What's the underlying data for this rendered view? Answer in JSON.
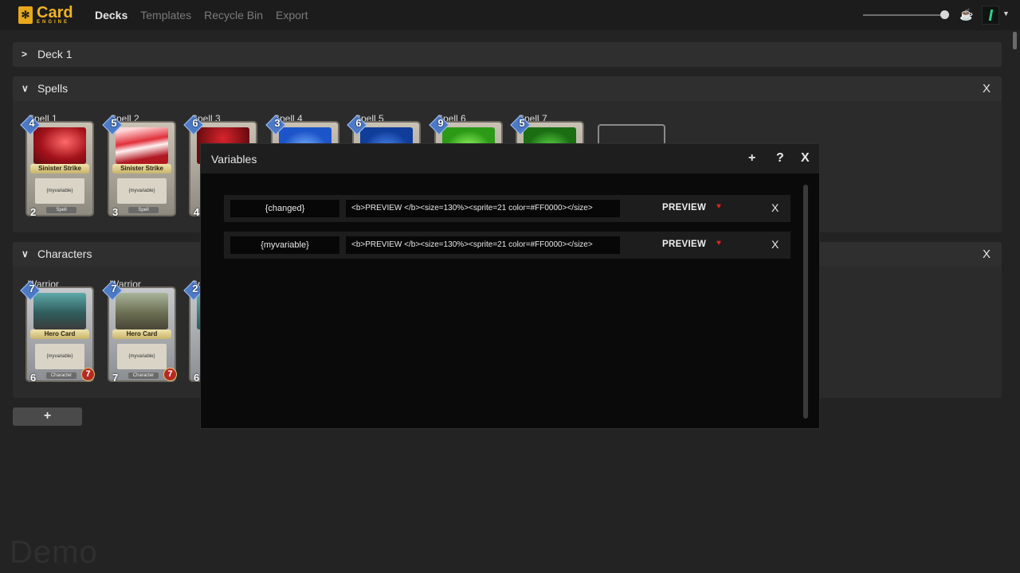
{
  "app": {
    "logo_top": "Card",
    "logo_bottom": "ENGINE",
    "nav": [
      "Decks",
      "Templates",
      "Recycle Bin",
      "Export"
    ],
    "active_nav": "Decks",
    "watermark": "Demo"
  },
  "decks": [
    {
      "name": "Deck 1",
      "expanded": false
    },
    {
      "name": "Spells",
      "expanded": true,
      "close_label": "X",
      "cards": [
        {
          "name": "Spell 1",
          "cost": "4",
          "attack": "2",
          "title": "Sinister Strike",
          "text": "{myvariable}",
          "type": "Spell",
          "art": "red"
        },
        {
          "name": "Spell 2",
          "cost": "5",
          "attack": "3",
          "title": "Sinister Strike",
          "text": "{myvariable}",
          "type": "Spell",
          "art": "red"
        },
        {
          "name": "Spell 3",
          "cost": "6",
          "attack": "4",
          "art": "red"
        },
        {
          "name": "Spell 4",
          "cost": "3",
          "art": "blue"
        },
        {
          "name": "Spell 5",
          "cost": "6",
          "art": "blue"
        },
        {
          "name": "Spell 6",
          "cost": "9",
          "art": "green"
        },
        {
          "name": "Spell 7",
          "cost": "5",
          "art": "green"
        }
      ]
    },
    {
      "name": "Characters",
      "expanded": true,
      "close_label": "X",
      "cards": [
        {
          "name": "Warrior",
          "cost": "7",
          "attack": "6",
          "health": "7",
          "title": "Hero Card",
          "text": "{myvariable}",
          "type": "Character",
          "art": "teal"
        },
        {
          "name": "Warrior",
          "cost": "7",
          "attack": "7",
          "health": "7",
          "title": "Hero Card",
          "text": "{myvariable}",
          "type": "Character",
          "art": "olive"
        },
        {
          "name": "Sr",
          "cost": "2",
          "attack": "6",
          "art": "teal"
        }
      ]
    }
  ],
  "add_deck_label": "+",
  "modal": {
    "title": "Variables",
    "add_label": "+",
    "help_label": "?",
    "close_label": "X",
    "variables": [
      {
        "name": "{changed}",
        "value": "<b>PREVIEW </b><size=130%><sprite=21 color=#FF0000></size>",
        "preview": "PREVIEW",
        "delete_label": "X"
      },
      {
        "name": "{myvariable}",
        "value": "<b>PREVIEW </b><size=130%><sprite=21 color=#FF0000></size>",
        "preview": "PREVIEW",
        "delete_label": "X"
      }
    ]
  },
  "colors": {
    "accent": "#f0b323",
    "preview_sprite": "#FF0000"
  }
}
